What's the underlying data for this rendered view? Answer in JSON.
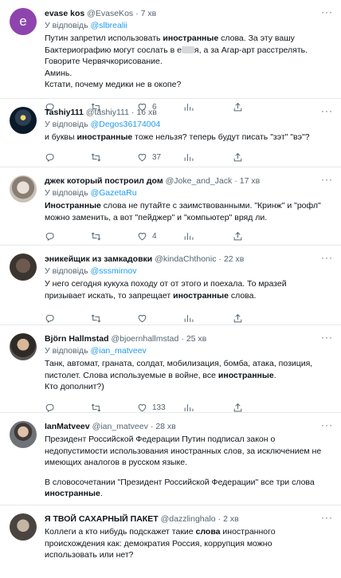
{
  "reply_prefix": "У відповідь",
  "tweets": [
    {
      "name": "evase kos",
      "handle": "@EvaseKos",
      "time": "7 хв",
      "reply_to": "@slbrealii",
      "text_parts": [
        "Путин запретил использовать ",
        "иностранные",
        " слова. За эту вашу Бактериографию могут сослать в е",
        "",
        "я, а за Агар-арт расстрелять. Говорите Червячкорисование."
      ],
      "line2": "Аминь.",
      "line3": "Кстати, почему медики не в окопе?",
      "counts": {
        "replies": "",
        "retweets": "",
        "likes": "6",
        "views": ""
      },
      "avatar_letter": "e",
      "avatar_color": "#8e44ad"
    },
    {
      "name": "Tashiy111",
      "handle": "@tashiy111",
      "time": "16 хв",
      "reply_to": "@Degos36174004",
      "text_parts": [
        "и буквы ",
        "иностранные",
        " тоже нельзя? теперь будут писать  \"зэт\" \"вэ\"?"
      ],
      "counts": {
        "replies": "",
        "retweets": "",
        "likes": "37",
        "views": ""
      }
    },
    {
      "name": "джек который построил дом",
      "handle": "@Joke_and_Jack",
      "time": "17 хв",
      "reply_to": "@GazetaRu",
      "text_parts": [
        "Иностранные",
        " слова не путайте с заимствованными. \"Кринж\" и \"рофл\" можно заменить, а вот \"пейджер\" и \"компьютер\" вряд ли."
      ],
      "counts": {
        "replies": "",
        "retweets": "",
        "likes": "4",
        "views": ""
      }
    },
    {
      "name": "эникейщик из замкадовки",
      "handle": "@kindaChthonic",
      "time": "22 хв",
      "reply_to": "@sssmirnov",
      "text_parts": [
        "У него сегодня кукуха походу от от этого и поехала. То мразей призывает искать, то запрещает ",
        "иностранные",
        " слова."
      ],
      "counts": {
        "replies": "",
        "retweets": "",
        "likes": "",
        "views": ""
      }
    },
    {
      "name": "Björn Hallmstad",
      "handle": "@bjoernhallmstad",
      "time": "25 хв",
      "reply_to": "@ian_matveev",
      "text_parts": [
        "Танк, автомат, граната, солдат, мобилизация, бомба, атака, позиция, пистолет. Слова используемые в войне, все ",
        "иностранные",
        "."
      ],
      "line2": "Кто дополнит?)",
      "counts": {
        "replies": "",
        "retweets": "",
        "likes": "133",
        "views": ""
      }
    },
    {
      "name": "IanMatveev",
      "handle": "@ian_matveev",
      "time": "28 хв",
      "text_parts": [
        "Президент Российской Федерации Путин подписал закон о недопустимости использования иностранных слов, за исключением не имеющих аналогов в русском языке."
      ],
      "para2_parts": [
        "В словосочетании \"Президент Российской Федерации\" все три слова ",
        "иностранные",
        "."
      ]
    },
    {
      "name": "Я ТВОЙ САХАРНЫЙ ПАКЕТ",
      "handle": "@dazzlinghalo",
      "time": "2 хв",
      "text_parts": [
        "Коллеги а кто нибудь подскажет такие ",
        "слова",
        " иностранного происхождения как: демократия Россия, коррупция можно использовать или нет?"
      ]
    }
  ],
  "colors": {
    "link": "#1d9bf0",
    "muted": "#536471",
    "text": "#0f1419",
    "divider": "#e7e9ea"
  }
}
